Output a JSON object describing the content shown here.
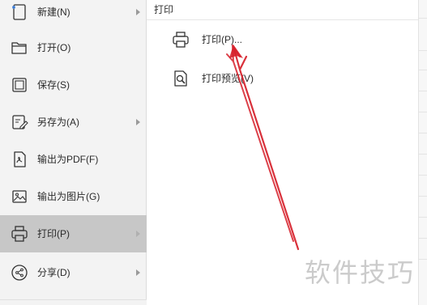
{
  "left_menu": {
    "items": [
      {
        "label": "新建(N)",
        "icon": "new-document-icon",
        "has_submenu": true,
        "active": false
      },
      {
        "label": "打开(O)",
        "icon": "folder-open-icon",
        "has_submenu": false,
        "active": false
      },
      {
        "label": "保存(S)",
        "icon": "save-icon",
        "has_submenu": false,
        "active": false
      },
      {
        "label": "另存为(A)",
        "icon": "save-as-icon",
        "has_submenu": true,
        "active": false
      },
      {
        "label": "输出为PDF(F)",
        "icon": "export-pdf-icon",
        "has_submenu": false,
        "active": false
      },
      {
        "label": "输出为图片(G)",
        "icon": "export-image-icon",
        "has_submenu": false,
        "active": false
      },
      {
        "label": "打印(P)",
        "icon": "printer-icon",
        "has_submenu": true,
        "active": true
      },
      {
        "label": "分享(D)",
        "icon": "share-icon",
        "has_submenu": true,
        "active": false
      }
    ]
  },
  "submenu": {
    "title": "打印",
    "items": [
      {
        "label": "打印(P)...",
        "icon": "printer-icon"
      },
      {
        "label": "打印预览(V)",
        "icon": "print-preview-icon"
      }
    ]
  },
  "annotation": {
    "type": "red-arrows",
    "color": "#d6202a"
  },
  "watermark": {
    "text": "软件技巧"
  },
  "colors": {
    "menu_background": "#f3f3f3",
    "active_item": "#c7c7c7",
    "icon_stroke": "#333333"
  }
}
